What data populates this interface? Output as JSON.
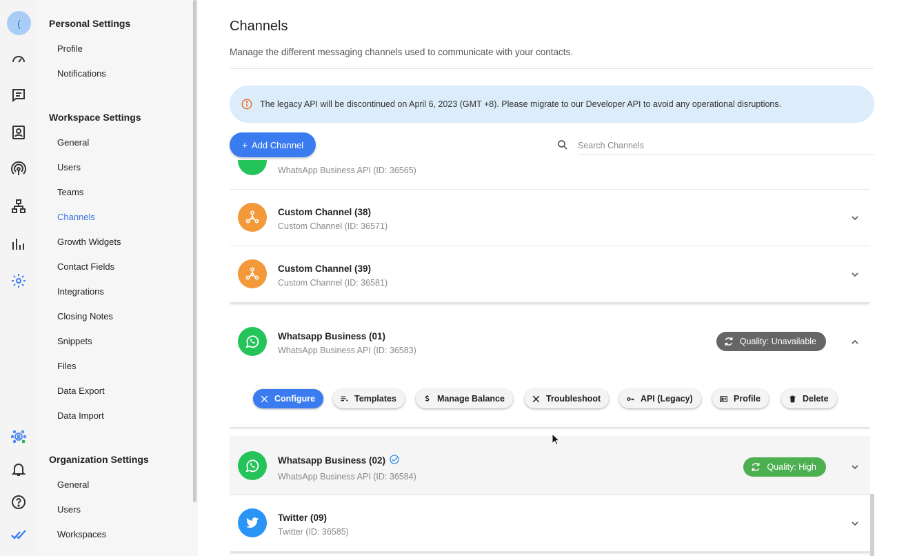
{
  "rail": {
    "avatar_initial": "(",
    "items": [
      "dashboard-icon",
      "chat-icon",
      "contacts-icon",
      "broadcast-icon",
      "workflow-icon",
      "reports-icon",
      "settings-icon",
      "workspace-avatar-icon",
      "bell-icon",
      "help-icon",
      "brand-check-icon"
    ]
  },
  "nav": {
    "personal_title": "Personal Settings",
    "personal_items": [
      "Profile",
      "Notifications"
    ],
    "workspace_title": "Workspace Settings",
    "workspace_items": [
      "General",
      "Users",
      "Teams",
      "Channels",
      "Growth Widgets",
      "Contact Fields",
      "Integrations",
      "Closing Notes",
      "Snippets",
      "Files",
      "Data Export",
      "Data Import"
    ],
    "organization_title": "Organization Settings",
    "organization_items": [
      "General",
      "Users",
      "Workspaces"
    ],
    "active": "Channels"
  },
  "main": {
    "title": "Channels",
    "subtitle": "Manage the different messaging channels used to communicate with your contacts.",
    "banner": "The legacy API will be discontinued on April 6, 2023 (GMT +8). Please migrate to our Developer API to avoid any operational disruptions.",
    "add_button": "Add Channel",
    "search_placeholder": "Search Channels"
  },
  "channels": [
    {
      "name": "",
      "sub": "WhatsApp Business API (ID: 36565)"
    },
    {
      "name": "Custom Channel (38)",
      "sub": "Custom Channel (ID: 36571)"
    },
    {
      "name": "Custom Channel (39)",
      "sub": "Custom Channel (ID: 36581)"
    },
    {
      "name": "Whatsapp Business (01)",
      "sub": "WhatsApp Business API (ID: 36583)",
      "quality": "Quality: Unavailable"
    },
    {
      "name": "Whatsapp Business (02)",
      "sub": "WhatsApp Business API (ID: 36584)",
      "quality": "Quality: High"
    },
    {
      "name": "Twitter (09)",
      "sub": "Twitter (ID: 36585)"
    }
  ],
  "actions": [
    "Configure",
    "Templates",
    "Manage Balance",
    "Troubleshoot",
    "API (Legacy)",
    "Profile",
    "Delete"
  ],
  "colors": {
    "accent": "#3a7bef",
    "whatsapp": "#25c45a",
    "custom": "#f3993a",
    "twitter": "#2a95f5",
    "quality_high": "#4caf50",
    "quality_unavailable": "#666666"
  }
}
